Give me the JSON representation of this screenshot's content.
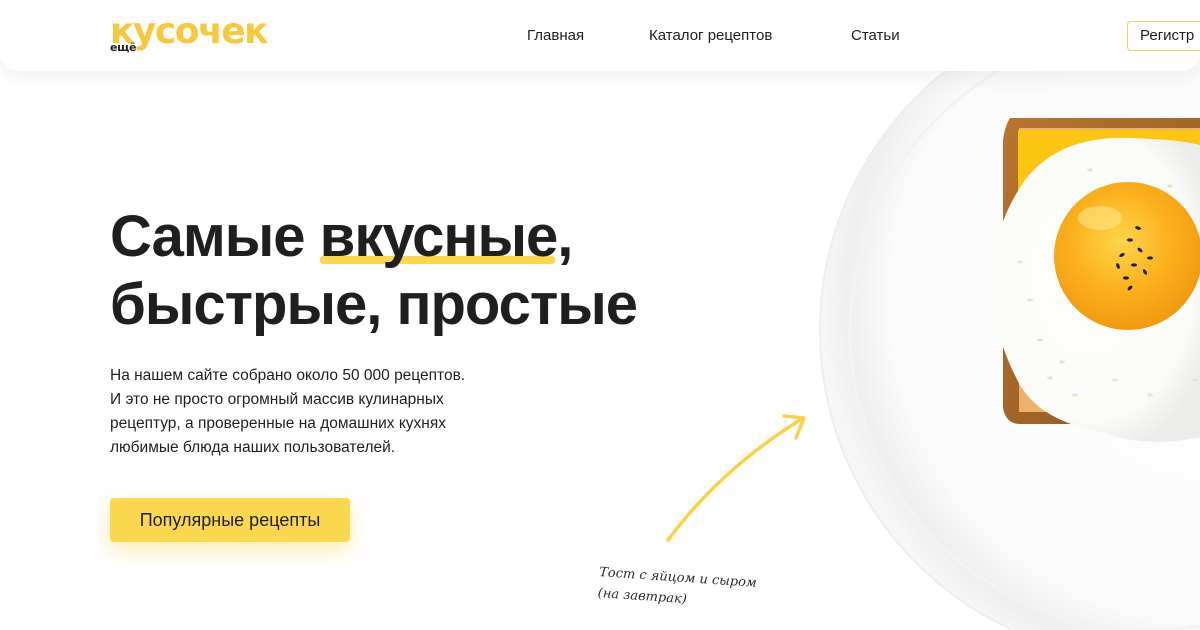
{
  "header": {
    "logo": {
      "main": "кусочек",
      "sub": "ещё"
    },
    "nav": [
      {
        "label": "Главная"
      },
      {
        "label": "Каталог рецептов"
      },
      {
        "label": "Статьи"
      }
    ],
    "register_label": "Регистр"
  },
  "hero": {
    "headline_part1": "Самые ",
    "headline_highlight": "вкусные",
    "headline_part2": ",",
    "headline_line2": "быстрые, простые",
    "description_lines": [
      "На нашем сайте собрано около 50 000 рецептов.",
      "И это не просто огромный массив кулинарных",
      "рецептур, а проверенные на домашних кухнях",
      "любимые блюда наших пользователей."
    ],
    "cta_label": "Популярные рецепты"
  },
  "illustration": {
    "caption_lines": [
      "Тост с яйцом и сыром",
      "(на завтрак)"
    ]
  },
  "colors": {
    "accent": "#fcd84e",
    "logo": "#f6c83b",
    "text": "#1f1f1f",
    "yolk": "#f7a817",
    "cheese": "#fcc511"
  }
}
